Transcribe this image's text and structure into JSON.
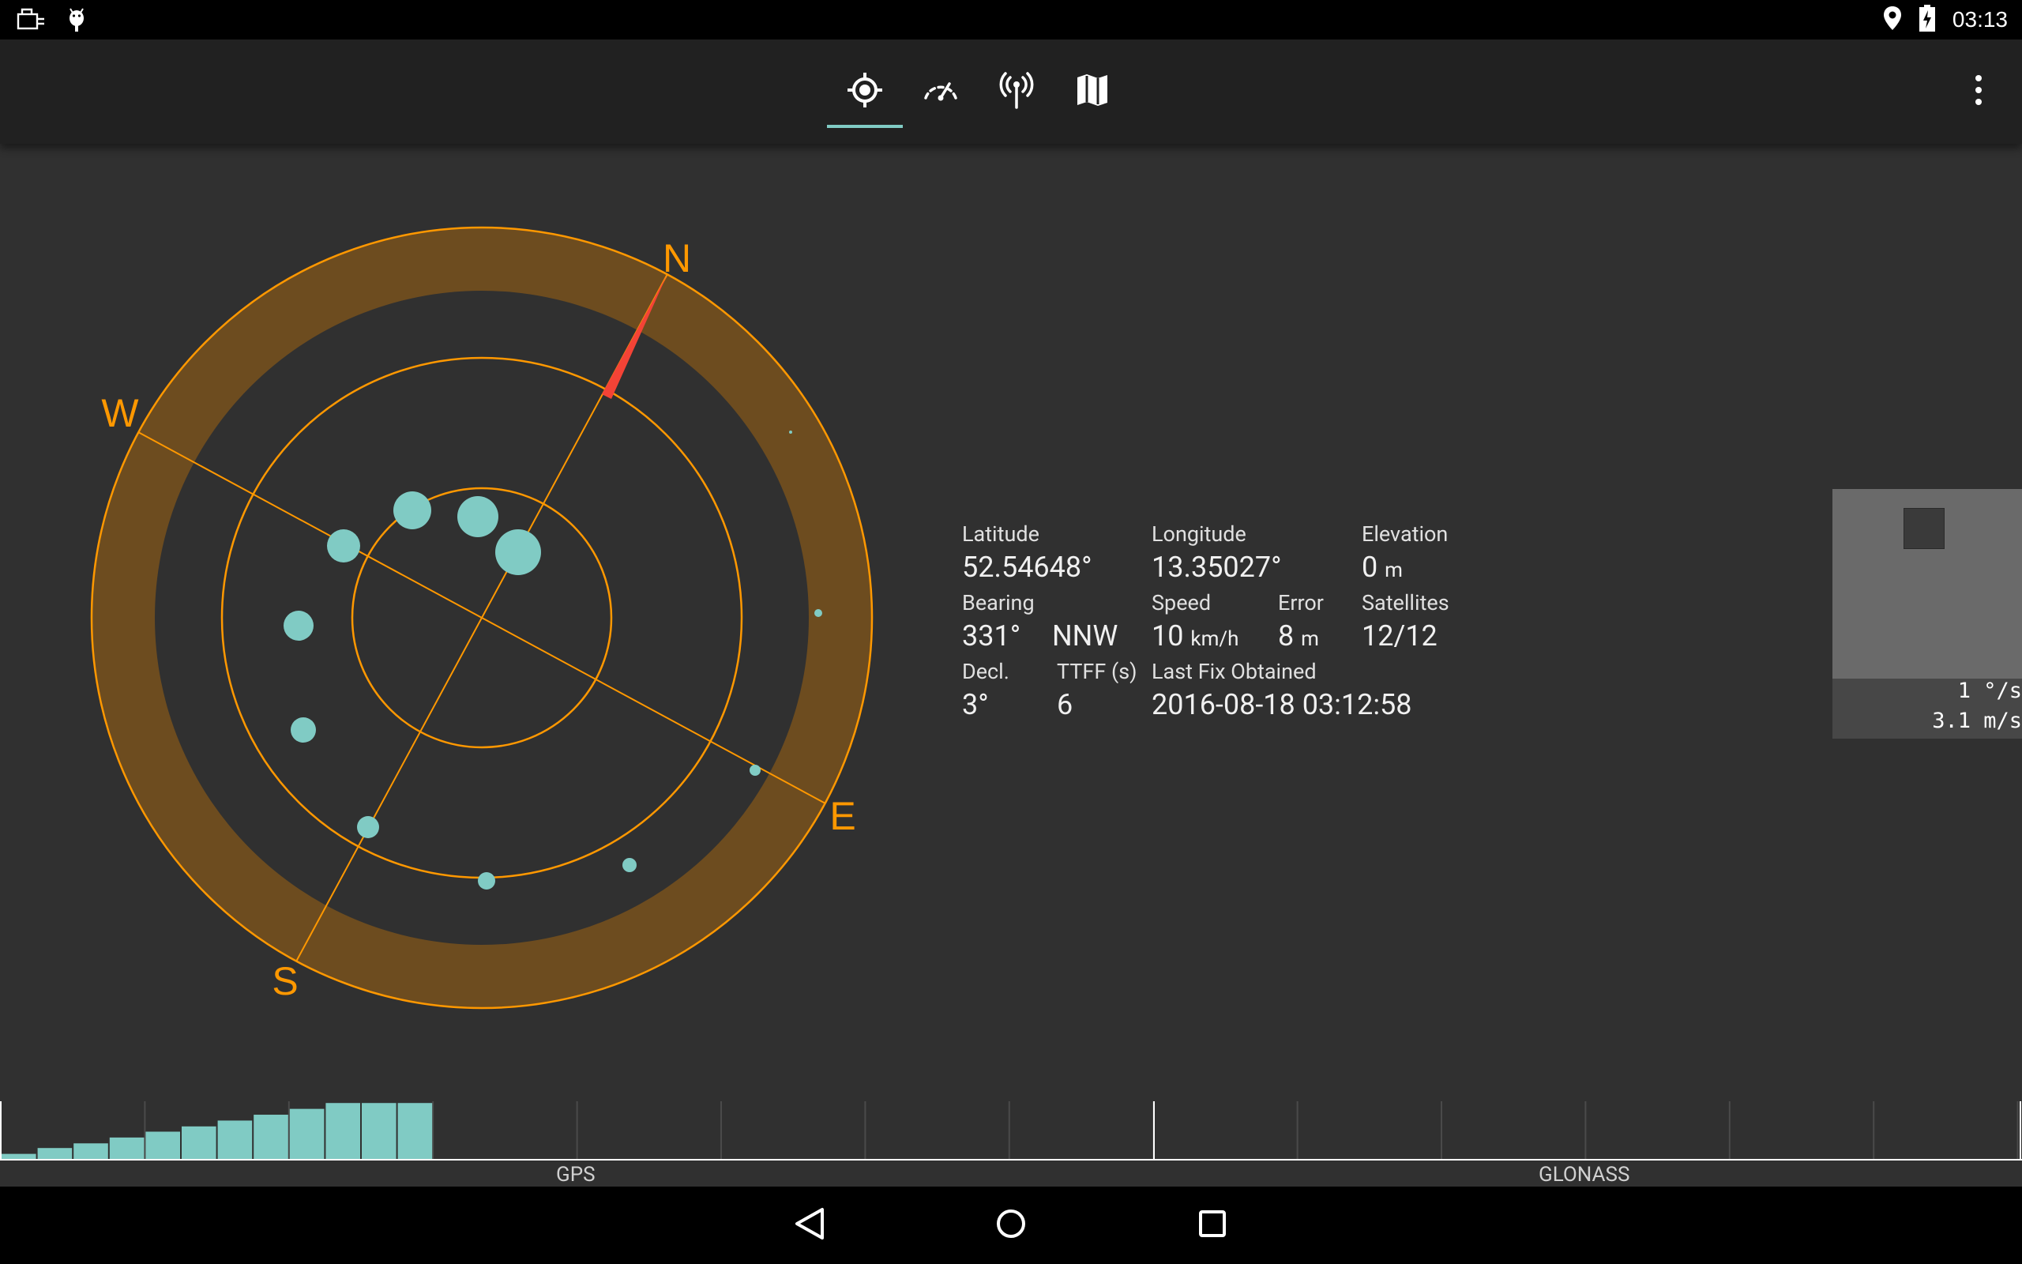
{
  "status_bar": {
    "time": "03:13",
    "left_icons": [
      "usb-icon",
      "android-debug-icon"
    ],
    "right_icons": [
      "location-pin-icon",
      "battery-charging-icon"
    ]
  },
  "toolbar": {
    "tabs": [
      {
        "name": "position",
        "icon": "gps-fix-icon",
        "active": true
      },
      {
        "name": "speed",
        "icon": "speedometer-icon",
        "active": false
      },
      {
        "name": "signal",
        "icon": "antenna-icon",
        "active": false
      },
      {
        "name": "map",
        "icon": "map-icon",
        "active": false
      }
    ],
    "overflow_icon": "more-vert-icon"
  },
  "sky_view": {
    "compass_labels": {
      "n": "N",
      "e": "E",
      "s": "S",
      "w": "W"
    },
    "bearing_deg": 331,
    "accent_color": "#ff9800",
    "ring_fill": "#6d4c1f",
    "satellite_color": "#80cbc4",
    "needle_color": "#f44336"
  },
  "info": {
    "latitude_label": "Latitude",
    "latitude": "52.54648°",
    "longitude_label": "Longitude",
    "longitude": "13.35027°",
    "elevation_label": "Elevation",
    "elevation": "0",
    "elevation_unit": "m",
    "bearing_label": "Bearing",
    "bearing": "331°",
    "bearing_dir": "NNW",
    "speed_label": "Speed",
    "speed": "10",
    "speed_unit": "km/h",
    "error_label": "Error",
    "error": "8",
    "error_unit": "m",
    "satellites_label": "Satellites",
    "satellites": "12/12",
    "decl_label": "Decl.",
    "decl": "3°",
    "ttff_label": "TTFF (s)",
    "ttff": "6",
    "last_fix_label": "Last Fix Obtained",
    "last_fix": "2016-08-18 03:12:58"
  },
  "gyro": {
    "rotation": "  1 °/s",
    "acceleration": "3.1 m/s"
  },
  "snr_chart": {
    "gps_label": "GPS",
    "glonass_label": "GLONASS",
    "gps_snr_fraction": [
      0.1,
      0.2,
      0.28,
      0.38,
      0.48,
      0.57,
      0.67,
      0.77,
      0.87,
      0.97,
      0.97,
      0.97
    ],
    "bar_color": "#80cbc4"
  },
  "nav_bar": {
    "icons": [
      "back-icon",
      "home-icon",
      "recents-icon"
    ]
  }
}
